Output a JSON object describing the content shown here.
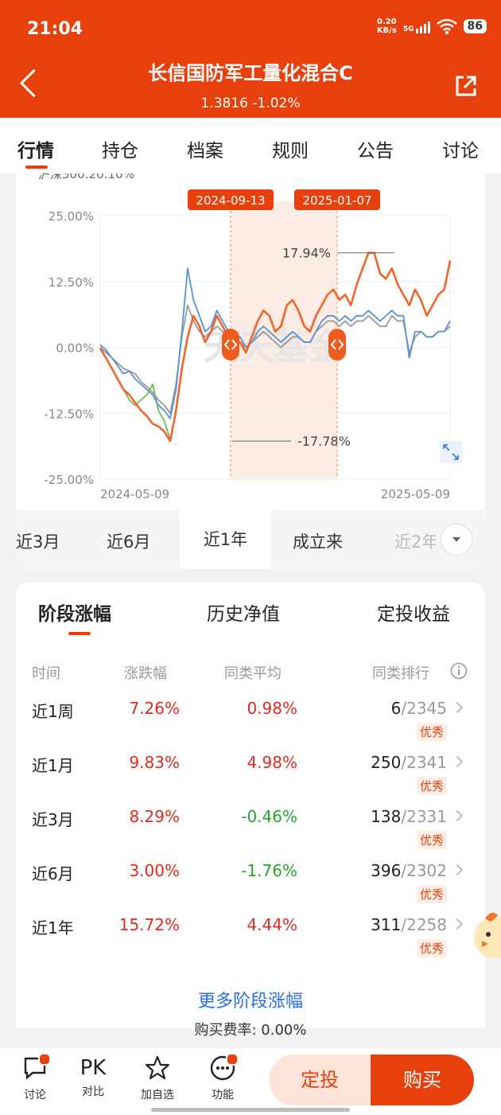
{
  "status": {
    "time": "21:04",
    "net_speed": "0.20",
    "net_unit": "KB/s",
    "net_type": "5G",
    "battery": "86"
  },
  "header": {
    "title": "长信国防军工量化混合C",
    "subtitle": "1.3816 -1.02%"
  },
  "tabs": [
    "行情",
    "持仓",
    "档案",
    "规则",
    "公告",
    "讨论"
  ],
  "legend_partial": "沪深300:20.10%",
  "chart_data": {
    "type": "line",
    "y_ticks": [
      "25.00%",
      "12.50%",
      "0.00%",
      "-12.50%",
      "-25.00%"
    ],
    "x_labels": [
      "2024-05-09",
      "2025-05-09"
    ],
    "ylim": [
      -25,
      25
    ],
    "highlight_range": [
      "2024-09-13",
      "2025-01-07"
    ],
    "annotations": {
      "max": "17.94%",
      "min": "-17.78%"
    },
    "watermark": "天天基金",
    "series": [
      {
        "color": "#f0652a",
        "values": [
          -0.2,
          -2,
          -4,
          -6,
          -8,
          -9,
          -10.5,
          -12,
          -13,
          -14.5,
          -15,
          -16,
          -17.78,
          -12,
          -4,
          2,
          6,
          4,
          1,
          3,
          6,
          4,
          2,
          0,
          1,
          -1,
          2,
          5,
          7,
          6,
          3,
          4,
          8,
          9,
          7,
          4,
          3,
          6,
          8,
          10,
          11,
          9,
          10,
          8,
          12,
          15,
          17.94,
          17.94,
          14,
          13,
          15,
          12,
          10,
          8,
          11,
          9,
          6,
          8,
          10,
          11,
          16.5
        ]
      },
      {
        "color": "#5b8fd6",
        "values": [
          0.5,
          -0.5,
          -2,
          -3.5,
          -5,
          -4.5,
          -6,
          -7,
          -8,
          -9,
          -11,
          -12,
          -13.5,
          -8,
          3,
          15,
          9,
          6,
          3,
          4,
          7,
          5,
          3,
          2,
          2,
          0,
          1,
          3,
          4,
          3,
          2,
          1,
          2,
          3,
          2,
          1,
          1,
          3,
          5,
          6,
          6,
          5,
          6,
          5,
          6,
          6,
          7,
          6,
          5,
          6,
          7,
          6,
          6,
          -2,
          3,
          3,
          2,
          2,
          3,
          3,
          5
        ]
      },
      {
        "color": "#6ac04c",
        "values": [
          0,
          -2,
          -4,
          -6,
          -8,
          -10,
          -11,
          -10,
          -9,
          -7,
          -12,
          -14,
          -17.5
        ]
      },
      {
        "color": "#999999",
        "values": [
          0,
          -1,
          -2,
          -3,
          -4,
          -4.5,
          -5,
          -6.5,
          -7.5,
          -8.5,
          -10,
          -11,
          -12.5,
          -7,
          2,
          8,
          5,
          3,
          2,
          3,
          4,
          3,
          2,
          1,
          1,
          0,
          1,
          2,
          3,
          2,
          1,
          0,
          1,
          2,
          2,
          1,
          1,
          3,
          4,
          5,
          5,
          4,
          5,
          4,
          5,
          5,
          6,
          5,
          4,
          4,
          6,
          5,
          5,
          -1,
          2,
          3,
          2,
          2,
          3,
          3,
          4
        ]
      }
    ]
  },
  "periods": [
    "近3月",
    "近6月",
    "近1年",
    "成立来",
    "近2年"
  ],
  "sub_tabs": [
    "阶段涨幅",
    "历史净值",
    "定投收益"
  ],
  "table": {
    "headers": [
      "时间",
      "涨跌幅",
      "同类平均",
      "同类排行"
    ],
    "rows": [
      {
        "name": "近1周",
        "chg": "7.26%",
        "avg": "0.98%",
        "avg_color": "#e02a20",
        "rank": "6",
        "total": "/2345",
        "badge": "优秀"
      },
      {
        "name": "近1月",
        "chg": "9.83%",
        "avg": "4.98%",
        "avg_color": "#e02a20",
        "rank": "250",
        "total": "/2341",
        "badge": "优秀"
      },
      {
        "name": "近3月",
        "chg": "8.29%",
        "avg": "-0.46%",
        "avg_color": "#27a32e",
        "rank": "138",
        "total": "/2331",
        "badge": "优秀"
      },
      {
        "name": "近6月",
        "chg": "3.00%",
        "avg": "-1.76%",
        "avg_color": "#27a32e",
        "rank": "396",
        "total": "/2302",
        "badge": "优秀"
      },
      {
        "name": "近1年",
        "chg": "15.72%",
        "avg": "4.44%",
        "avg_color": "#e02a20",
        "rank": "311",
        "total": "/2258",
        "badge": "优秀"
      }
    ]
  },
  "more_link": "更多阶段涨幅",
  "fee": "购买费率: 0.00%",
  "bottom": {
    "discuss": "讨论",
    "pk": "PK",
    "compare": "对比",
    "watch": "加自选",
    "func": "功能",
    "fixed": "定投",
    "buy": "购买"
  }
}
